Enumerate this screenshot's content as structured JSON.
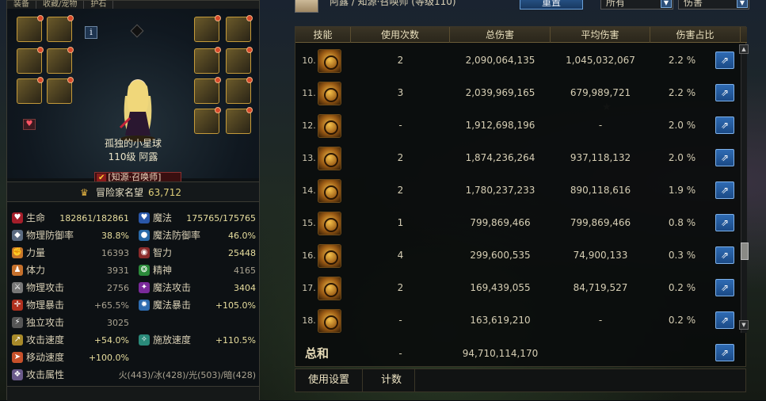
{
  "left": {
    "tabs": [
      "装备",
      "收藏/宠物",
      "护石"
    ],
    "info_icon": "i",
    "char": {
      "name": "孤独的小星球",
      "level_line": "110级 阿露",
      "job": "[知源·召唤师]"
    },
    "renown": {
      "label": "冒险家名望",
      "value": "63,712"
    },
    "stats": {
      "hp_label": "生命",
      "hp_value": "182861/182861",
      "mp_label": "魔法",
      "mp_value": "175765/175765",
      "pdef_label": "物理防御率",
      "pdef_value": "38.8%",
      "mdef_label": "魔法防御率",
      "mdef_value": "46.0%",
      "str_label": "力量",
      "str_value": "16393",
      "int_label": "智力",
      "int_value": "25448",
      "vit_label": "体力",
      "vit_value": "3931",
      "spr_label": "精神",
      "spr_value": "4165",
      "patk_label": "物理攻击",
      "patk_value": "2756",
      "matk_label": "魔法攻击",
      "matk_value": "3404",
      "pcrit_label": "物理暴击",
      "pcrit_value": "+65.5%",
      "mcrit_label": "魔法暴击",
      "mcrit_value": "+105.0%",
      "ind_label": "独立攻击",
      "ind_value": "3025",
      "aspd_label": "攻击速度",
      "aspd_value": "+54.0%",
      "cspd_label": "施放速度",
      "cspd_value": "+110.5%",
      "mspd_label": "移动速度",
      "mspd_value": "+100.0%",
      "elem_label": "攻击属性",
      "elem_value": "火(443)/冰(428)/光(503)/暗(428)"
    }
  },
  "right": {
    "header": {
      "title": "阿露 / 知源·召唤师 (等级110)",
      "reset_label": "重置",
      "filter_value": "所有",
      "metric_value": "伤害"
    },
    "columns": [
      "技能",
      "使用次数",
      "总伤害",
      "平均伤害",
      "伤害占比"
    ],
    "rows": [
      {
        "idx": "10.",
        "uses": "2",
        "total": "2,090,064,135",
        "avg": "1,045,032,067",
        "pct": "2.2 %"
      },
      {
        "idx": "11.",
        "uses": "3",
        "total": "2,039,969,165",
        "avg": "679,989,721",
        "pct": "2.2 %"
      },
      {
        "idx": "12.",
        "uses": "-",
        "total": "1,912,698,196",
        "avg": "-",
        "pct": "2.0 %"
      },
      {
        "idx": "13.",
        "uses": "2",
        "total": "1,874,236,264",
        "avg": "937,118,132",
        "pct": "2.0 %"
      },
      {
        "idx": "14.",
        "uses": "2",
        "total": "1,780,237,233",
        "avg": "890,118,616",
        "pct": "1.9 %"
      },
      {
        "idx": "15.",
        "uses": "1",
        "total": "799,869,466",
        "avg": "799,869,466",
        "pct": "0.8 %"
      },
      {
        "idx": "16.",
        "uses": "4",
        "total": "299,600,535",
        "avg": "74,900,133",
        "pct": "0.3 %"
      },
      {
        "idx": "17.",
        "uses": "2",
        "total": "169,439,055",
        "avg": "84,719,527",
        "pct": "0.2 %"
      },
      {
        "idx": "18.",
        "uses": "-",
        "total": "163,619,210",
        "avg": "-",
        "pct": "0.2 %"
      }
    ],
    "total": {
      "label": "总和",
      "uses": "-",
      "total": "94,710,114,170"
    },
    "bottom_tabs": [
      "使用设置",
      "计数"
    ]
  },
  "colors": {
    "accent_gold": "#c49a3a",
    "button_blue": "#2b5a90",
    "hp_red": "#d8363a"
  }
}
